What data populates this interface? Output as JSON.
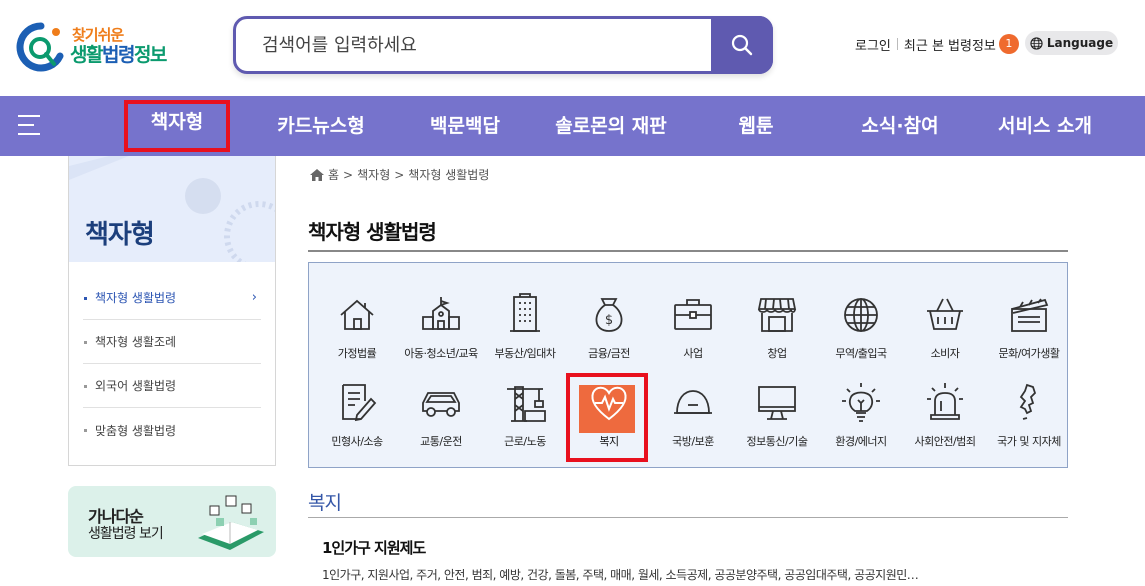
{
  "header": {
    "logo_sub": "찾기쉬운",
    "logo_main_green": "생활",
    "logo_main_blue": "법령",
    "logo_main_green2": "정보",
    "search_placeholder": "검색어를 입력하세요",
    "login": "로그인",
    "recent": "최근 본 법령정보",
    "recent_count": "1",
    "language": "Language"
  },
  "nav": {
    "items": [
      "책자형",
      "카드뉴스형",
      "백문백답",
      "솔로몬의 재판",
      "웹툰",
      "소식·참여",
      "서비스 소개"
    ],
    "active_index": 0
  },
  "sidebar": {
    "title": "책자형",
    "items": [
      "책자형 생활법령",
      "책자형 생활조례",
      "외국어 생활법령",
      "맞춤형 생활법령"
    ],
    "active_index": 0,
    "arrow": "›",
    "banner_line1": "가나다순",
    "banner_line2": "생활법령 보기"
  },
  "breadcrumb": {
    "home": "홈",
    "sep": ">",
    "level1": "책자형",
    "level2": "책자형 생활법령"
  },
  "page_title": "책자형 생활법령",
  "categories": [
    {
      "label": "가정법률",
      "icon": "house-icon"
    },
    {
      "label": "아동·청소년/교육",
      "icon": "school-icon"
    },
    {
      "label": "부동산/임대차",
      "icon": "building-icon"
    },
    {
      "label": "금융/금전",
      "icon": "money-bag-icon"
    },
    {
      "label": "사업",
      "icon": "briefcase-icon"
    },
    {
      "label": "창업",
      "icon": "store-icon"
    },
    {
      "label": "무역/출입국",
      "icon": "globe-icon"
    },
    {
      "label": "소비자",
      "icon": "basket-icon"
    },
    {
      "label": "문화/여가생활",
      "icon": "clapper-icon"
    },
    {
      "label": "민형사/소송",
      "icon": "document-pen-icon"
    },
    {
      "label": "교통/운전",
      "icon": "car-icon"
    },
    {
      "label": "근로/노동",
      "icon": "crane-icon"
    },
    {
      "label": "복지",
      "icon": "heart-pulse-icon"
    },
    {
      "label": "국방/보훈",
      "icon": "helmet-icon"
    },
    {
      "label": "정보통신/기술",
      "icon": "monitor-icon"
    },
    {
      "label": "환경/에너지",
      "icon": "lightbulb-icon"
    },
    {
      "label": "사회안전/범죄",
      "icon": "siren-icon"
    },
    {
      "label": "국가 및 지자체",
      "icon": "korea-map-icon"
    }
  ],
  "selected_category_index": 12,
  "colors": {
    "nav": "#7673cc",
    "search_border": "#5f5ab0",
    "highlight": "#e8101e",
    "selected_bg": "#ee6a3e",
    "section_title": "#3557a8"
  },
  "section": {
    "title": "복지",
    "item_title": "1인가구 지원제도",
    "item_desc": "1인가구, 지원사업, 주거, 안전, 범죄, 예방, 건강, 돌봄, 주택, 매매, 월세, 소득공제, 공공분양주택, 공공임대주택, 공공지원민…"
  }
}
